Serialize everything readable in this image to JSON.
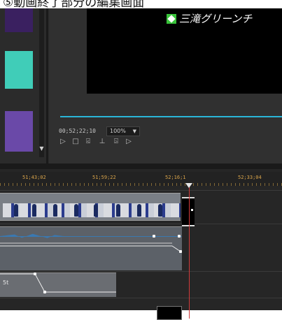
{
  "caption": "⑤動画終了部分の編集画面",
  "monitor": {
    "overlay_text": "三滝グリーンチ",
    "timecode": "00;52;22;10",
    "zoom": "100%",
    "controls": [
      "play-icon",
      "stop-icon",
      "mark-in-icon",
      "lift-icon",
      "mark-out-icon",
      "step-forward-icon"
    ]
  },
  "timeline": {
    "ruler_labels": [
      "51;43;02",
      "51;59;22",
      "52;16;1",
      "52;33;04"
    ],
    "lane3_label": "5t"
  },
  "colors": {
    "playhead": "#d23a3a",
    "scrub_line": "#2ab6d8",
    "ruler_text": "#d9a44a",
    "audio_wave": "#3a79b2"
  }
}
